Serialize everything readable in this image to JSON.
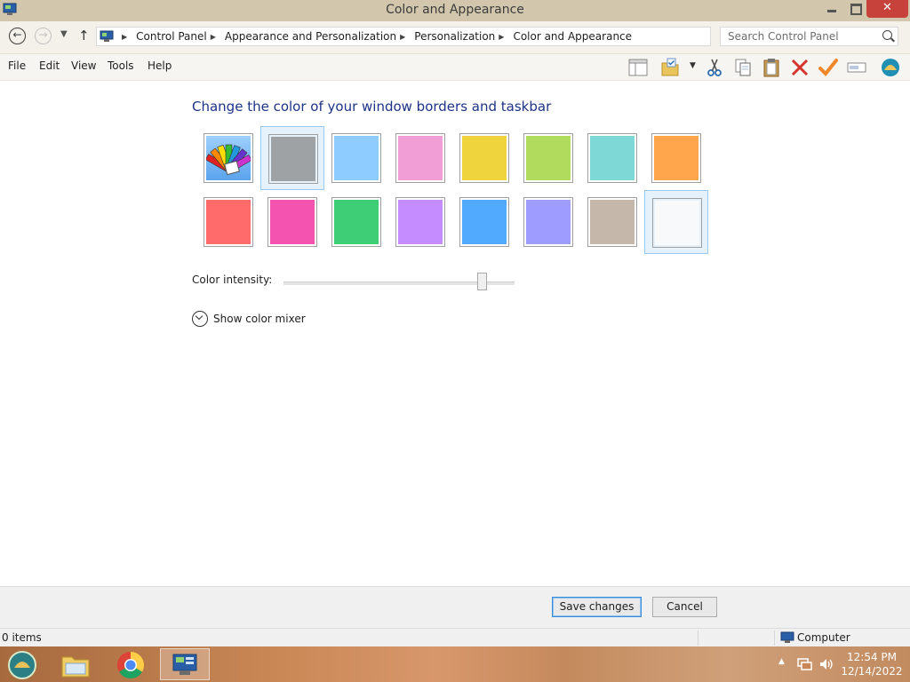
{
  "window": {
    "title": "Color and Appearance"
  },
  "address": {
    "crumbs": [
      "Control Panel",
      "Appearance and Personalization",
      "Personalization",
      "Color and Appearance"
    ],
    "search_placeholder": "Search Control Panel"
  },
  "menu": {
    "items": [
      "File",
      "Edit",
      "View",
      "Tools",
      "Help"
    ]
  },
  "toolbar_icons": [
    "layout-pane-icon",
    "properties-folder-icon",
    "cut-icon",
    "copy-icon",
    "paste-icon",
    "delete-icon",
    "check-icon",
    "rename-icon",
    "shell-icon"
  ],
  "main": {
    "heading": "Change the color of your window borders and taskbar",
    "swatches_row1": [
      {
        "name": "automatic",
        "color": "#7ab6f0",
        "icon": "color-fan-icon"
      },
      {
        "name": "sky-gray",
        "color": "#9ea2a5",
        "selected": true
      },
      {
        "name": "sky-blue",
        "color": "#8ecbff"
      },
      {
        "name": "pink",
        "color": "#f19ed6"
      },
      {
        "name": "yellow",
        "color": "#efd43d"
      },
      {
        "name": "lime",
        "color": "#b1db5c"
      },
      {
        "name": "teal",
        "color": "#7ed8d6"
      },
      {
        "name": "orange",
        "color": "#ffa54c"
      }
    ],
    "swatches_row2": [
      {
        "name": "red",
        "color": "#ff6b6b"
      },
      {
        "name": "magenta",
        "color": "#f453b0"
      },
      {
        "name": "green",
        "color": "#3ecf76"
      },
      {
        "name": "violet",
        "color": "#c58cff"
      },
      {
        "name": "blue",
        "color": "#52aaff"
      },
      {
        "name": "lavender",
        "color": "#9e9dff"
      },
      {
        "name": "taupe",
        "color": "#c5b8aa"
      },
      {
        "name": "frost",
        "color": "#f7f9fb",
        "highlighted": true
      }
    ],
    "intensity_label": "Color intensity:",
    "intensity_value": 0.86,
    "mixer_label": "Show color mixer"
  },
  "footer": {
    "save_label": "Save changes",
    "cancel_label": "Cancel"
  },
  "status": {
    "items_label": "0 items",
    "location_label": "Computer"
  },
  "taskbar": {
    "time": "12:54 PM",
    "date": "12/14/2022"
  }
}
